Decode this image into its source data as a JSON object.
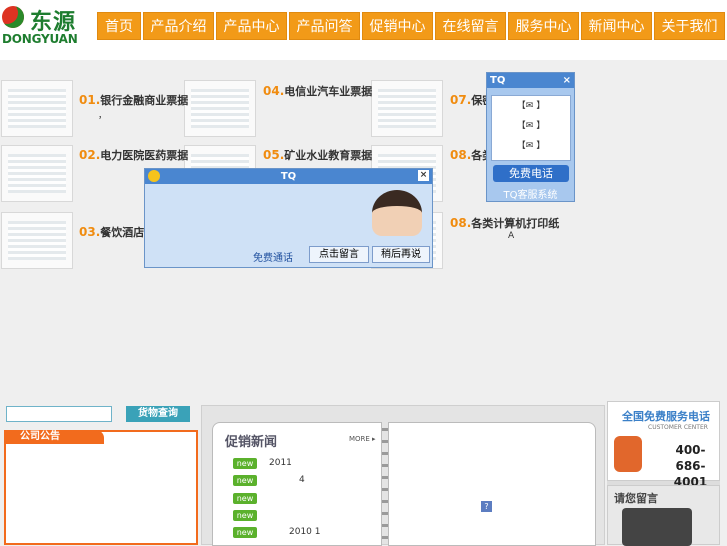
{
  "header": {
    "logo_cn": "东源",
    "logo_en": "DONGYUAN",
    "nav": [
      "首页",
      "产品介绍",
      "产品中心",
      "产品问答",
      "促销中心",
      "在线留言",
      "服务中心",
      "新闻中心",
      "关于我们"
    ]
  },
  "products": [
    {
      "num": "01.",
      "label": "银行金融商业票据"
    },
    {
      "num": "02.",
      "label": "电力医院医药票据"
    },
    {
      "num": "03.",
      "label": "餐饮酒店住"
    },
    {
      "num": "04.",
      "label": "电信业汽车业票据"
    },
    {
      "num": "05.",
      "label": "矿业水业教育票据"
    },
    {
      "num": "07.",
      "label": "保密"
    },
    {
      "num": "08.",
      "label": "各类"
    },
    {
      "num": "08.",
      "label": "各类计算机打印纸"
    }
  ],
  "stray": {
    "comma": "，",
    "a": "A"
  },
  "tq_side": {
    "title": "TQ",
    "close": "×",
    "rows": [
      "【✉ 】",
      "【✉ 】",
      "【✉ 】"
    ],
    "call": "免费电话",
    "system": "TQ客服系统"
  },
  "tq_popup": {
    "title": "TQ",
    "close": "×",
    "free_call": "免费通话",
    "leave_msg": "点击留言",
    "later": "稍后再说"
  },
  "search": {
    "placeholder": "",
    "button": "货物查询"
  },
  "notice": {
    "title": "公司公告"
  },
  "promo": {
    "title": "促销新闻",
    "more": "MORE ▸",
    "badge": "new",
    "items": [
      "2011",
      "4",
      "",
      "",
      "2010 1",
      ""
    ]
  },
  "service": {
    "title": "全国免费服务电话",
    "subtitle": "CUSTOMER CENTER",
    "phone1": "400-",
    "phone2": "686-4001",
    "msg": "请您留言"
  }
}
